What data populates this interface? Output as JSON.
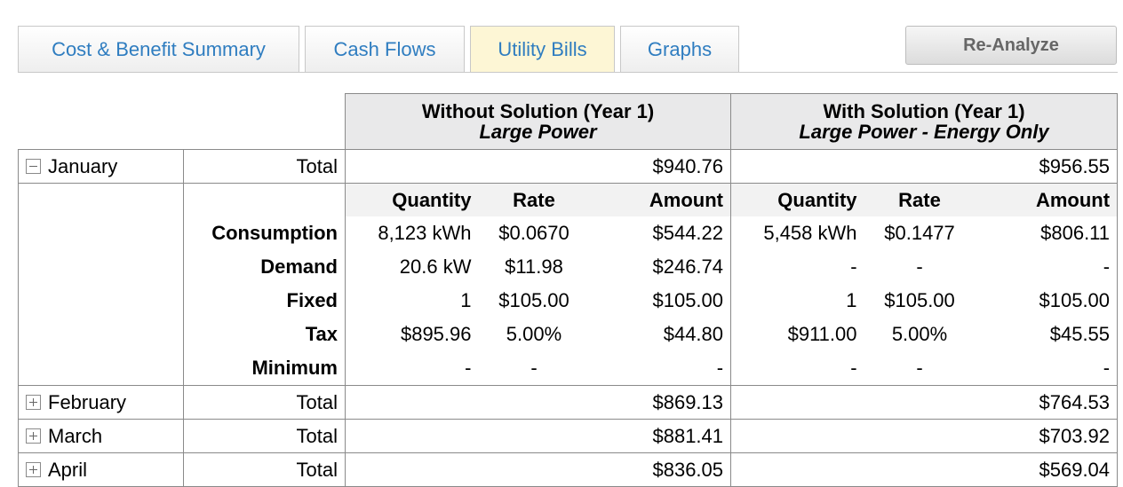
{
  "tabs": [
    {
      "label": "Cost & Benefit Summary",
      "active": false
    },
    {
      "label": "Cash Flows",
      "active": false
    },
    {
      "label": "Utility Bills",
      "active": true
    },
    {
      "label": "Graphs",
      "active": false
    }
  ],
  "reanalyze_label": "Re-Analyze",
  "headers": {
    "without": {
      "title": "Without Solution (Year 1)",
      "subtitle": "Large Power"
    },
    "with": {
      "title": "With Solution (Year 1)",
      "subtitle": "Large Power - Energy Only"
    }
  },
  "columns": {
    "quantity": "Quantity",
    "rate": "Rate",
    "amount": "Amount"
  },
  "total_label": "Total",
  "months": [
    {
      "name": "January",
      "expanded": true,
      "without_total": "$940.76",
      "with_total": "$956.55",
      "details": [
        {
          "label": "Consumption",
          "wo_qty": "8,123 kWh",
          "wo_rate": "$0.0670",
          "wo_amt": "$544.22",
          "w_qty": "5,458 kWh",
          "w_rate": "$0.1477",
          "w_amt": "$806.11"
        },
        {
          "label": "Demand",
          "wo_qty": "20.6 kW",
          "wo_rate": "$11.98",
          "wo_amt": "$246.74",
          "w_qty": "-",
          "w_rate": "-",
          "w_amt": "-"
        },
        {
          "label": "Fixed",
          "wo_qty": "1",
          "wo_rate": "$105.00",
          "wo_amt": "$105.00",
          "w_qty": "1",
          "w_rate": "$105.00",
          "w_amt": "$105.00"
        },
        {
          "label": "Tax",
          "wo_qty": "$895.96",
          "wo_rate": "5.00%",
          "wo_amt": "$44.80",
          "w_qty": "$911.00",
          "w_rate": "5.00%",
          "w_amt": "$45.55"
        },
        {
          "label": "Minimum",
          "wo_qty": "-",
          "wo_rate": "-",
          "wo_amt": "-",
          "w_qty": "-",
          "w_rate": "-",
          "w_amt": "-"
        }
      ]
    },
    {
      "name": "February",
      "expanded": false,
      "without_total": "$869.13",
      "with_total": "$764.53"
    },
    {
      "name": "March",
      "expanded": false,
      "without_total": "$881.41",
      "with_total": "$703.92"
    },
    {
      "name": "April",
      "expanded": false,
      "without_total": "$836.05",
      "with_total": "$569.04"
    }
  ]
}
